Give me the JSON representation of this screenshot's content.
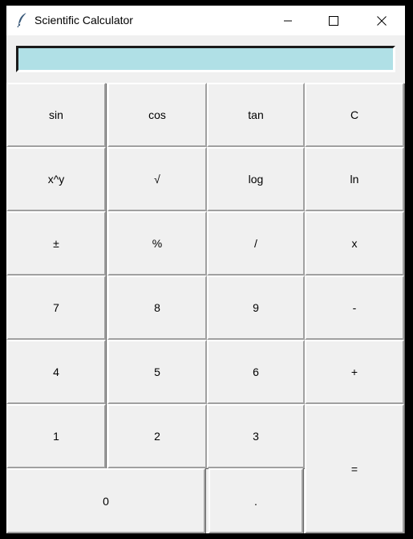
{
  "window": {
    "title": "Scientific Calculator",
    "controls": {
      "minimize": "minimize-icon",
      "maximize": "maximize-icon",
      "close": "close-icon"
    }
  },
  "display": {
    "value": "",
    "background": "#b0e0e6"
  },
  "keys": {
    "sin": "sin",
    "cos": "cos",
    "tan": "tan",
    "clear": "C",
    "power": "x^y",
    "sqrt": "√",
    "log": "log",
    "ln": "ln",
    "negate": "±",
    "percent": "%",
    "divide": "/",
    "multiply": "x",
    "seven": "7",
    "eight": "8",
    "nine": "9",
    "minus": "-",
    "four": "4",
    "five": "5",
    "six": "6",
    "plus": "+",
    "one": "1",
    "two": "2",
    "three": "3",
    "equals": "=",
    "zero": "0",
    "decimal": "."
  }
}
